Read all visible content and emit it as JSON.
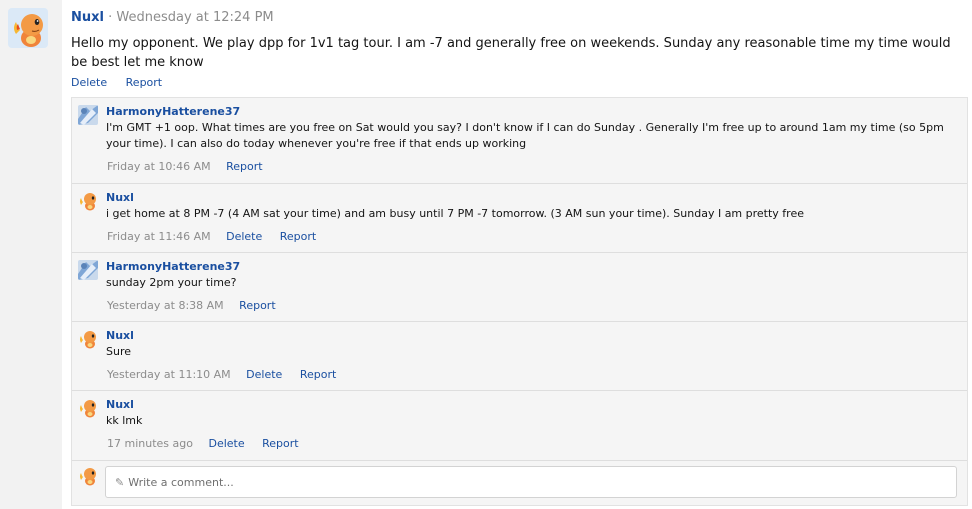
{
  "post": {
    "author": "Nuxl",
    "meta": "· Wednesday at 12:24 PM",
    "text": "Hello my opponent. We play dpp for 1v1 tag tour. I am -7 and generally free on weekends. Sunday any reasonable time my time would be best let me know",
    "delete_label": "Delete",
    "report_label": "Report"
  },
  "comments": [
    {
      "author": "HarmonyHatterene37",
      "text": "I'm GMT +1 oop. What times are you free on Sat would you say? I don't know if I can do Sunday . Generally I'm free up to around 1am my time (so 5pm your time). I can also do today whenever you're free if that ends up working",
      "time": "Friday at 10:46 AM",
      "report_label": "Report",
      "avatar": "harmony-avatar"
    },
    {
      "author": "Nuxl",
      "text": "i get home at 8 PM -7 (4 AM sat your time) and am busy until 7 PM -7 tomorrow. (3 AM sun your time). Sunday I am pretty free",
      "time": "Friday at 11:46 AM",
      "delete_label": "Delete",
      "report_label": "Report",
      "avatar": "charmander-avatar"
    },
    {
      "author": "HarmonyHatterene37",
      "text": "sunday 2pm your time?",
      "time": "Yesterday at 8:38 AM",
      "report_label": "Report",
      "avatar": "harmony-avatar"
    },
    {
      "author": "Nuxl",
      "text": "Sure",
      "time": "Yesterday at 11:10 AM",
      "delete_label": "Delete",
      "report_label": "Report",
      "avatar": "charmander-avatar"
    },
    {
      "author": "Nuxl",
      "text": "kk lmk",
      "time": "17 minutes ago",
      "delete_label": "Delete",
      "report_label": "Report",
      "avatar": "charmander-avatar"
    }
  ],
  "write_comment": {
    "placeholder": "Write a comment...",
    "icon": "pencil-icon"
  },
  "colors": {
    "link": "#1a4fa0",
    "muted": "#8c8c8c",
    "comment_bg": "#f5f5f5"
  }
}
